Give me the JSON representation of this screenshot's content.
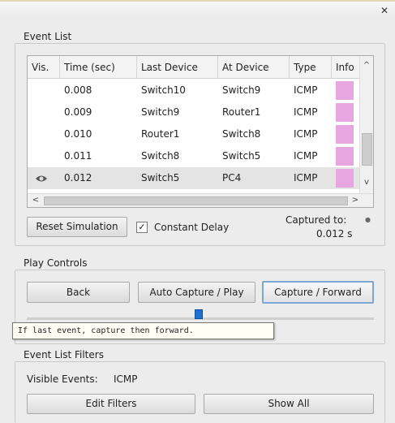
{
  "window": {
    "close_label": "✕"
  },
  "event_list": {
    "title": "Event List",
    "columns": [
      "Vis.",
      "Time (sec)",
      "Last Device",
      "At Device",
      "Type",
      "Info"
    ],
    "rows": [
      {
        "vis": "",
        "time": "0.008",
        "last": "Switch10",
        "at": "Switch9",
        "type": "ICMP",
        "color": "#e8a6e0"
      },
      {
        "vis": "",
        "time": "0.009",
        "last": "Switch9",
        "at": "Router1",
        "type": "ICMP",
        "color": "#e8a6e0"
      },
      {
        "vis": "",
        "time": "0.010",
        "last": "Router1",
        "at": "Switch8",
        "type": "ICMP",
        "color": "#e8a6e0"
      },
      {
        "vis": "",
        "time": "0.011",
        "last": "Switch8",
        "at": "Switch5",
        "type": "ICMP",
        "color": "#e8a6e0"
      },
      {
        "vis": "eye-icon",
        "time": "0.012",
        "last": "Switch5",
        "at": "PC4",
        "type": "ICMP",
        "color": "#e8a6e0"
      }
    ],
    "scroll_left": "<",
    "scroll_right": ">",
    "scroll_up": "^",
    "scroll_down": "v"
  },
  "controls": {
    "reset_label": "Reset Simulation",
    "constant_delay_label": "Constant Delay",
    "constant_delay_checked": true,
    "captured_to_label": "Captured to:",
    "captured_to_value": "0.012 s"
  },
  "play_controls": {
    "title": "Play Controls",
    "back_label": "Back",
    "auto_label": "Auto Capture / Play",
    "forward_label": "Capture / Forward",
    "tooltip": "If last event, capture then forward."
  },
  "filters": {
    "title": "Event List Filters",
    "visible_events_label": "Visible Events:",
    "visible_events_value": "ICMP",
    "edit_label": "Edit Filters",
    "show_all_label": "Show All"
  },
  "colors": {
    "info_swatch": "#e8a6e0",
    "slider": "#1f6fd0"
  }
}
